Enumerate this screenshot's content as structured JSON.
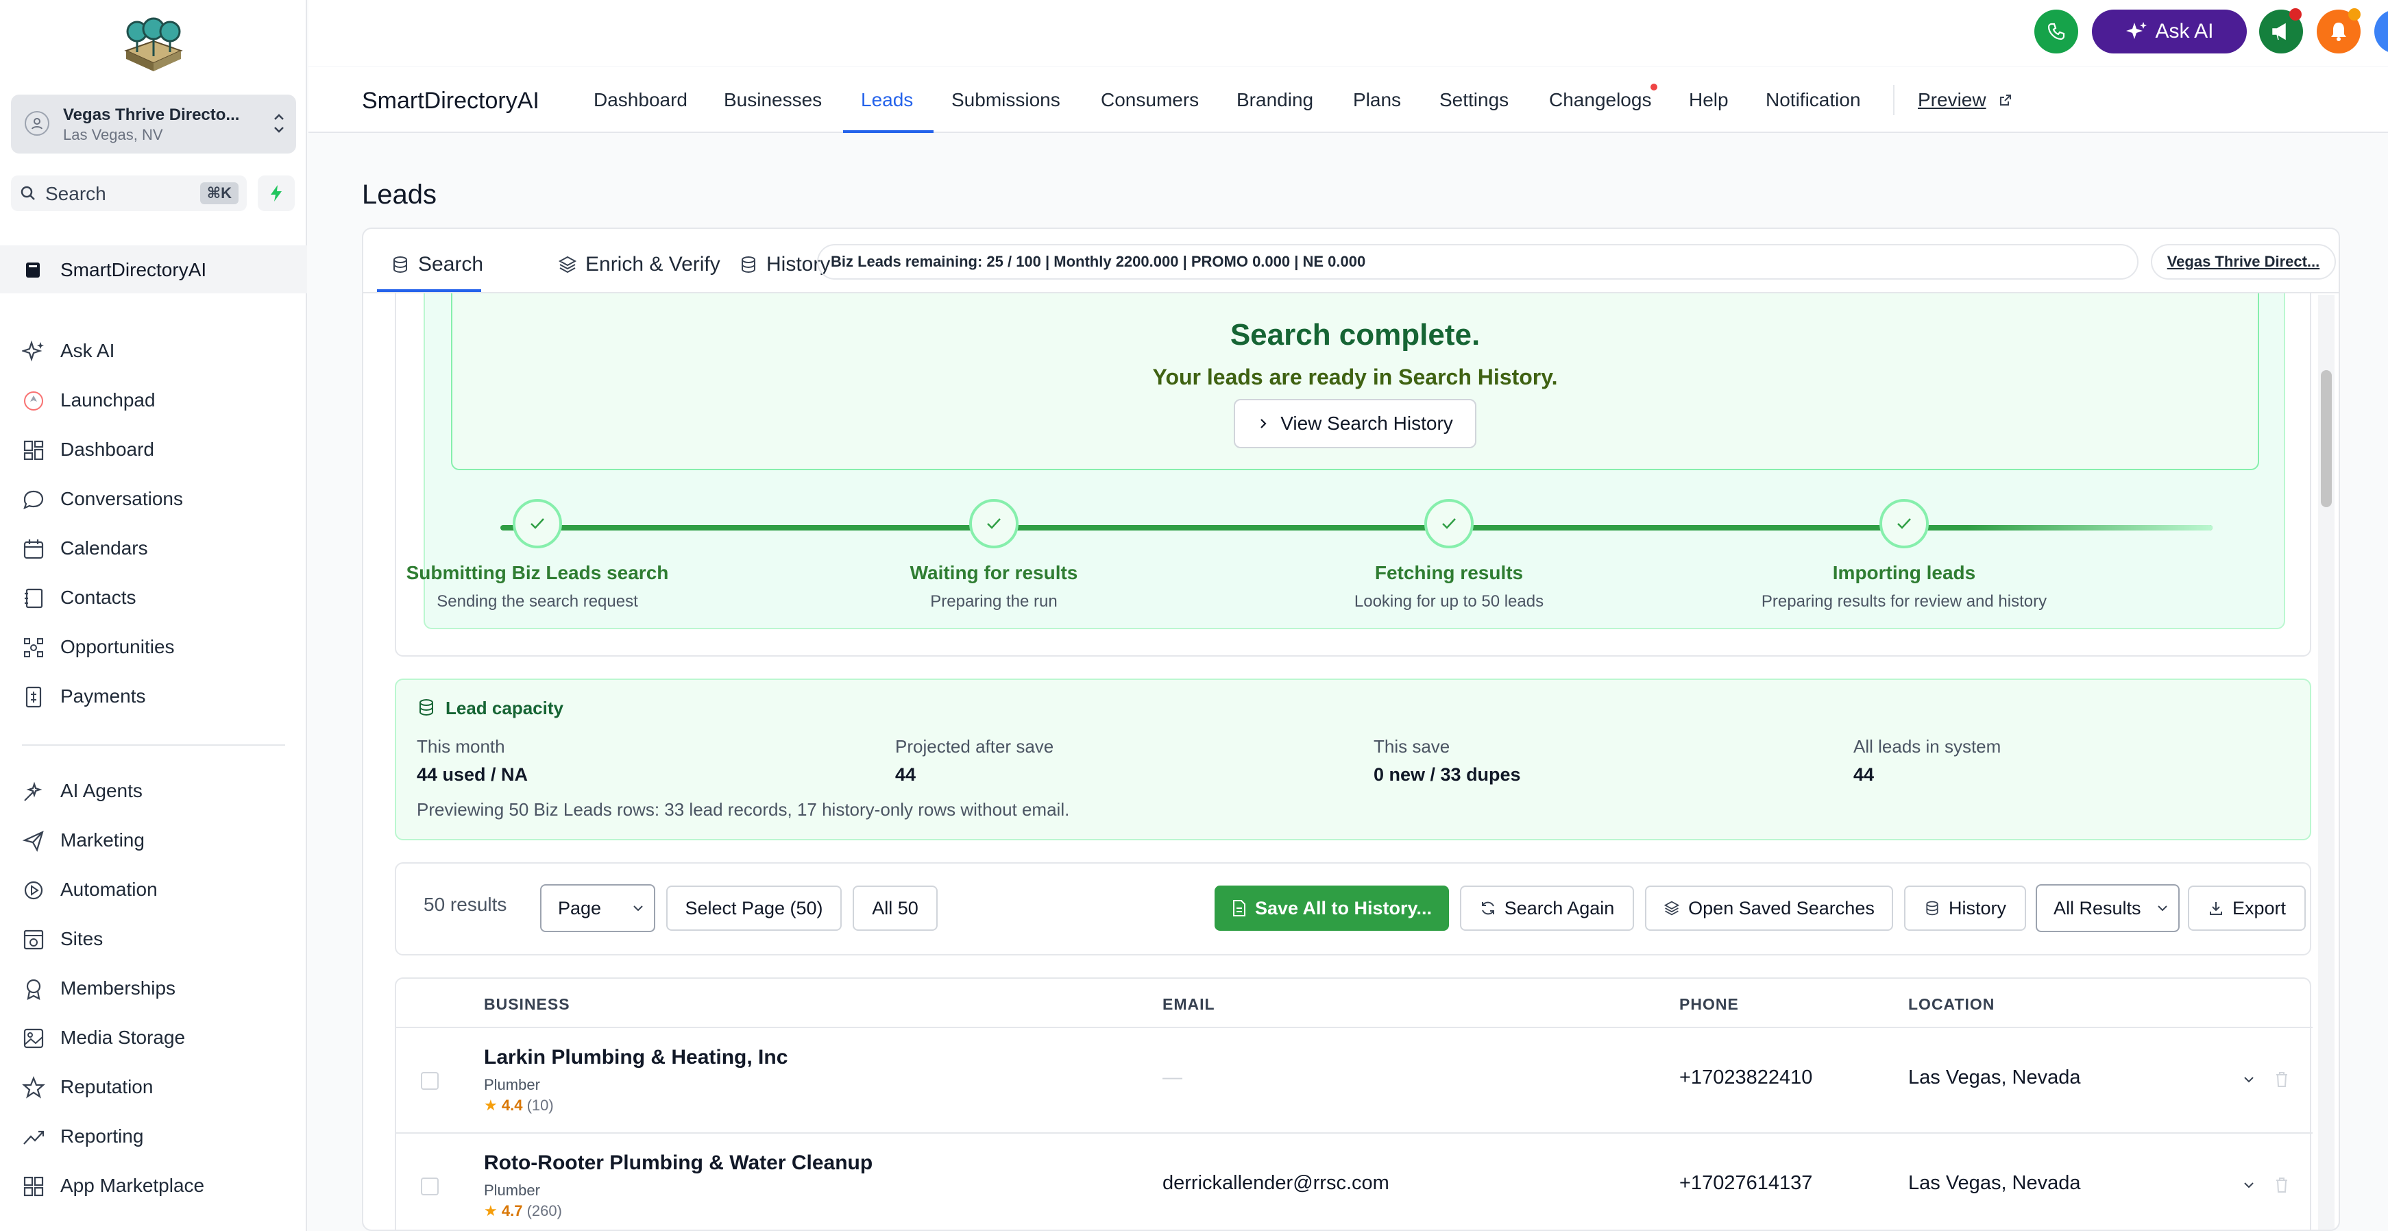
{
  "sidebar": {
    "location_name": "Vegas Thrive Directo...",
    "location_city": "Las Vegas, NV",
    "search_label": "Search",
    "search_shortcut": "⌘K",
    "active_item": "SmartDirectoryAI",
    "items": [
      {
        "label": "Ask AI",
        "icon": "sparkle-icon"
      },
      {
        "label": "Launchpad",
        "icon": "rocket-icon"
      },
      {
        "label": "Dashboard",
        "icon": "grid-icon"
      },
      {
        "label": "Conversations",
        "icon": "chat-icon"
      },
      {
        "label": "Calendars",
        "icon": "calendar-icon"
      },
      {
        "label": "Contacts",
        "icon": "contacts-icon"
      },
      {
        "label": "Opportunities",
        "icon": "pipeline-icon"
      },
      {
        "label": "Payments",
        "icon": "receipt-icon"
      },
      {
        "label": "AI Agents",
        "icon": "agent-icon"
      },
      {
        "label": "Marketing",
        "icon": "send-icon"
      },
      {
        "label": "Automation",
        "icon": "automation-icon"
      },
      {
        "label": "Sites",
        "icon": "globe-icon"
      },
      {
        "label": "Memberships",
        "icon": "badge-icon"
      },
      {
        "label": "Media Storage",
        "icon": "image-icon"
      },
      {
        "label": "Reputation",
        "icon": "star-icon"
      },
      {
        "label": "Reporting",
        "icon": "trend-icon"
      },
      {
        "label": "App Marketplace",
        "icon": "apps-icon"
      }
    ]
  },
  "topbar": {
    "ask_ai_label": "Ask AI",
    "help_label": "?"
  },
  "appnav": {
    "title": "SmartDirectoryAI",
    "tabs": [
      "Dashboard",
      "Businesses",
      "Leads",
      "Submissions",
      "Consumers",
      "Branding",
      "Plans",
      "Settings",
      "Changelogs",
      "Help",
      "Notification",
      "Preview"
    ],
    "active_tab": "Leads"
  },
  "page": {
    "title": "Leads",
    "subtabs": [
      "Search",
      "Enrich & Verify",
      "History"
    ],
    "credits": "Biz Leads remaining: 25 / 100 | Monthly 2200.000 | PROMO 0.000 | NE 0.000",
    "account_link": "Vegas Thrive Direct..."
  },
  "progress": {
    "title": "Search complete.",
    "subtitle": "Your leads are ready in Search History.",
    "view_button": "View Search History",
    "steps": [
      {
        "title": "Submitting Biz Leads search",
        "desc": "Sending the search request"
      },
      {
        "title": "Waiting for results",
        "desc": "Preparing the run"
      },
      {
        "title": "Fetching results",
        "desc": "Looking for up to 50 leads"
      },
      {
        "title": "Importing leads",
        "desc": "Preparing results for review and history"
      }
    ]
  },
  "capacity": {
    "title": "Lead capacity",
    "cols": [
      {
        "label": "This month",
        "value": "44 used / NA"
      },
      {
        "label": "Projected after save",
        "value": "44"
      },
      {
        "label": "This save",
        "value": "0 new / 33 dupes"
      },
      {
        "label": "All leads in system",
        "value": "44"
      }
    ],
    "note": "Previewing 50 Biz Leads rows: 33 lead records, 17 history-only rows without email."
  },
  "toolbar": {
    "count": "50 results",
    "page_select": "Page",
    "select_page": "Select Page (50)",
    "all": "All 50",
    "save_all": "Save All to History...",
    "search_again": "Search Again",
    "open_saved": "Open Saved Searches",
    "history": "History",
    "filter_select": "All Results",
    "export": "Export"
  },
  "table": {
    "headers": [
      "BUSINESS",
      "EMAIL",
      "PHONE",
      "LOCATION"
    ],
    "rows": [
      {
        "name": "Larkin Plumbing & Heating, Inc",
        "category": "Plumber",
        "rating": "4.4",
        "reviews": "(10)",
        "email": "—",
        "phone": "+17023822410",
        "location": "Las Vegas, Nevada"
      },
      {
        "name": "Roto-Rooter Plumbing & Water Cleanup",
        "category": "Plumber",
        "rating": "4.7",
        "reviews": "(260)",
        "email": "derrickallender@rrsc.com",
        "phone": "+17027614137",
        "location": "Las Vegas, Nevada"
      }
    ]
  },
  "colors": {
    "accent": "#2563eb",
    "success": "#2f9e44",
    "ask_ai": "#4c1d95"
  }
}
